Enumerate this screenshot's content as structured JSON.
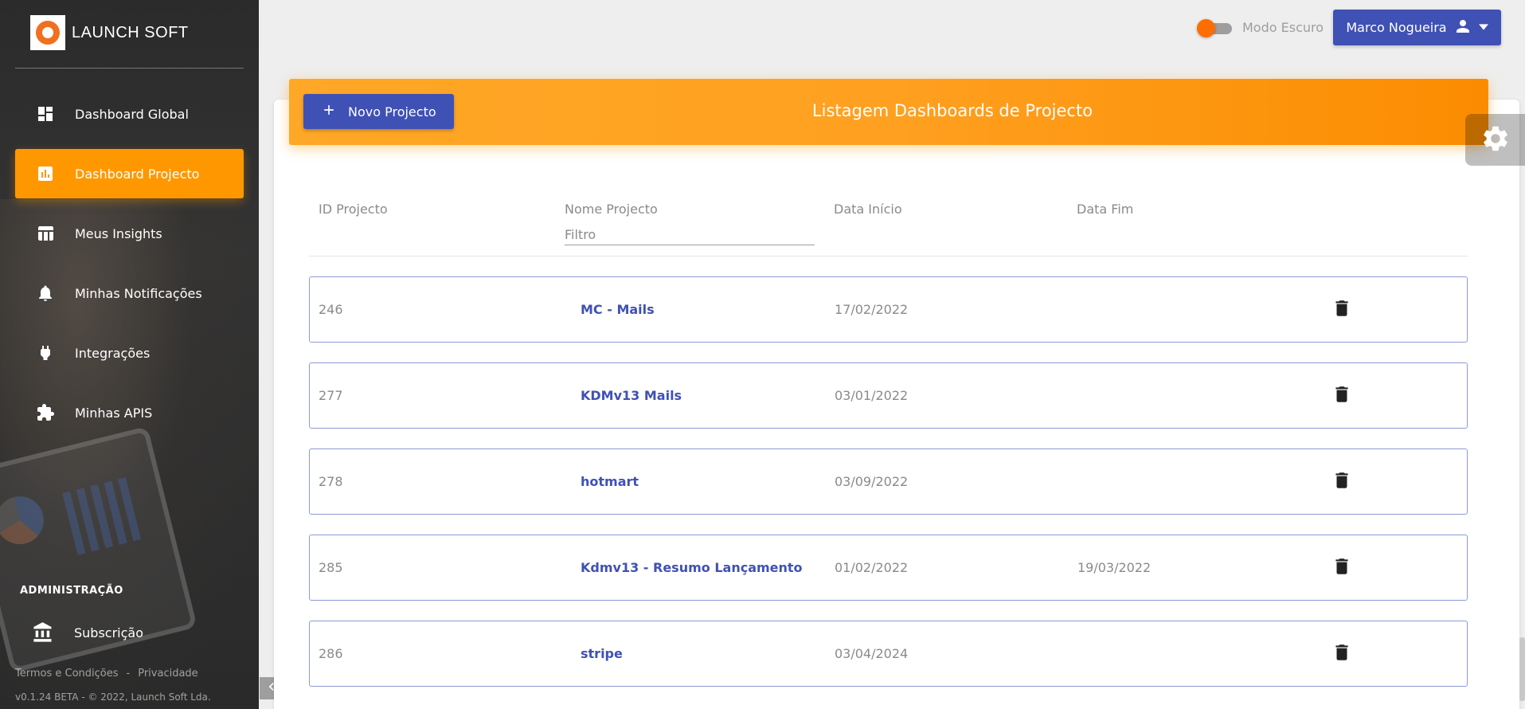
{
  "brand": {
    "name": "LAUNCH SOFT",
    "logo_text": "LAUNCH SOFT"
  },
  "sidebar": {
    "items": [
      {
        "label": "Dashboard Global",
        "icon": "dashboard-icon",
        "active": false
      },
      {
        "label": "Dashboard Projecto",
        "icon": "chart-icon",
        "active": true
      },
      {
        "label": "Meus Insights",
        "icon": "table-icon",
        "active": false
      },
      {
        "label": "Minhas Notificações",
        "icon": "bell-icon",
        "active": false
      },
      {
        "label": "Integrações",
        "icon": "plug-icon",
        "active": false
      },
      {
        "label": "Minhas APIS",
        "icon": "puzzle-icon",
        "active": false
      }
    ],
    "admin_title": "ADMINISTRAÇÃO",
    "admin_items": [
      {
        "label": "Subscrição",
        "icon": "bank-icon"
      }
    ],
    "footer": {
      "terms": "Termos e Condições",
      "separator": "-",
      "privacy": "Privacidade"
    },
    "copyright": "v0.1.24 BETA - © 2022, Launch Soft Lda."
  },
  "topbar": {
    "dark_mode_label": "Modo Escuro",
    "dark_mode_on": true,
    "user_name": "Marco Nogueira"
  },
  "card": {
    "title": "Listagem Dashboards de Projecto",
    "new_button": "Novo Projecto",
    "columns": [
      "ID Projecto",
      "Nome Projecto",
      "Data Início",
      "Data Fim"
    ],
    "filter_placeholder": "Filtro",
    "rows": [
      {
        "id": "246",
        "name": "MC - Mails",
        "start": "17/02/2022",
        "end": ""
      },
      {
        "id": "277",
        "name": "KDMv13 Mails",
        "start": "03/01/2022",
        "end": ""
      },
      {
        "id": "278",
        "name": "hotmart",
        "start": "03/09/2022",
        "end": ""
      },
      {
        "id": "285",
        "name": "Kdmv13 - Resumo Lançamento",
        "start": "01/02/2022",
        "end": "19/03/2022"
      },
      {
        "id": "286",
        "name": "stripe",
        "start": "03/04/2024",
        "end": ""
      }
    ]
  },
  "colors": {
    "accent_orange": "#ff9800",
    "primary_blue": "#3f51b5",
    "sidebar_bg": "#2b2b2b"
  }
}
